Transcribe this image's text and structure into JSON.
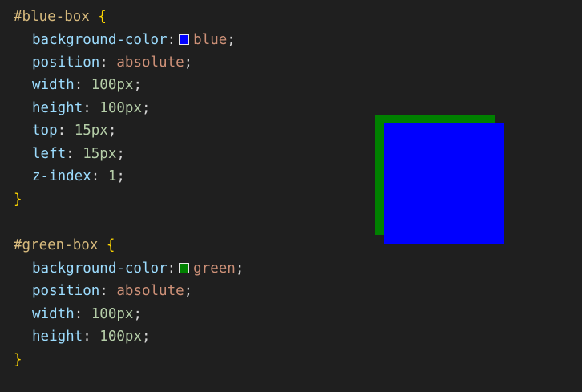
{
  "code": {
    "blue_rule": {
      "selector": "#blue-box",
      "open_brace": "{",
      "close_brace": "}",
      "declarations": [
        {
          "property": "background-color",
          "value": "blue",
          "swatch_color": "#0000ff"
        },
        {
          "property": "position",
          "value": "absolute"
        },
        {
          "property": "width",
          "value": "100px"
        },
        {
          "property": "height",
          "value": "100px"
        },
        {
          "property": "top",
          "value": "15px"
        },
        {
          "property": "left",
          "value": "15px"
        },
        {
          "property": "z-index",
          "value": "1"
        }
      ]
    },
    "green_rule": {
      "selector": "#green-box",
      "open_brace": "{",
      "close_brace": "}",
      "declarations": [
        {
          "property": "background-color",
          "value": "green",
          "swatch_color": "#008000"
        },
        {
          "property": "position",
          "value": "absolute"
        },
        {
          "property": "width",
          "value": "100px"
        },
        {
          "property": "height",
          "value": "100px"
        }
      ]
    }
  },
  "preview": {
    "green_box_color": "#008000",
    "blue_box_color": "#0000ff"
  }
}
